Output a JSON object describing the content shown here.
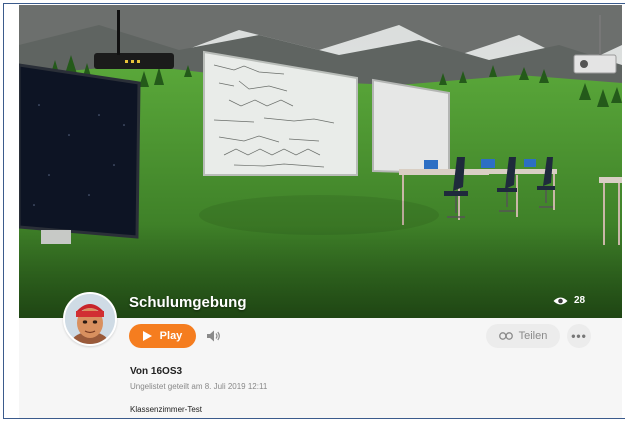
{
  "model": {
    "title": "Schulumgebung",
    "view_count": "28",
    "view_icon": "eye-icon"
  },
  "actions": {
    "play_label": "Play",
    "play_icon": "play-triangle-icon",
    "sound_icon": "speaker-icon",
    "share_label": "Teilen",
    "share_icon": "link-icon",
    "more_icon": "more-dots-icon"
  },
  "details": {
    "author": "Von 16OS3",
    "meta": "Ungelistet geteilt am 8. Juli 2019 12:11",
    "description": "Klassenzimmer-Test"
  },
  "colors": {
    "accent": "#f57d1f",
    "info_background": "#f6f6f6",
    "grass": "#3f8a2a"
  }
}
